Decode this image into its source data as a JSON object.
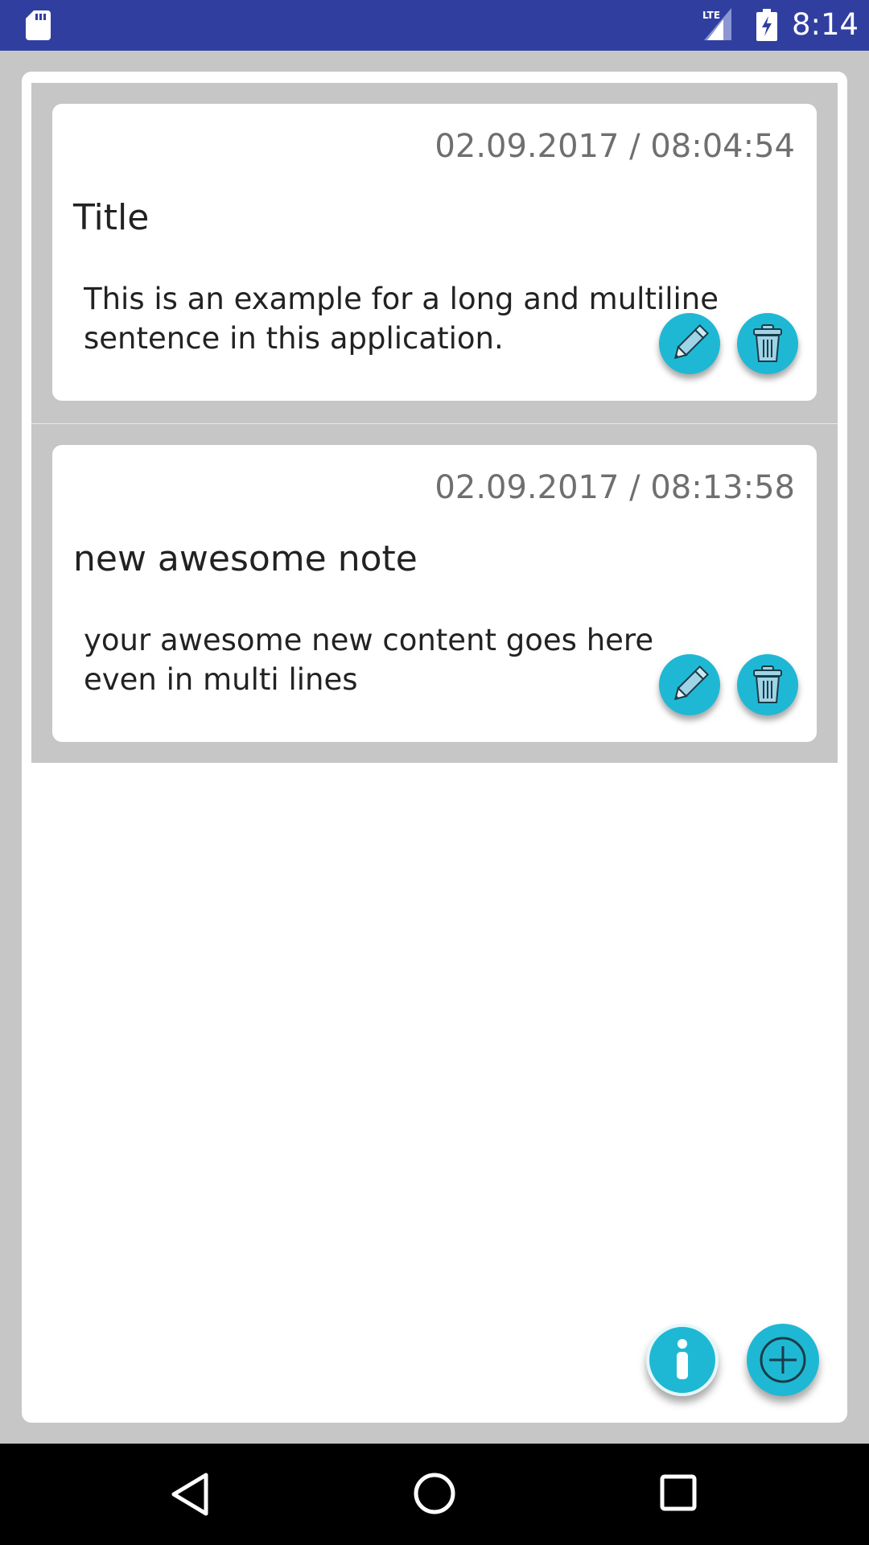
{
  "status_bar": {
    "time": "8:14",
    "network_label": "LTE",
    "icons": [
      "sd-card-icon",
      "lte-signal-icon",
      "battery-charging-icon"
    ],
    "background_color": "#303f9f"
  },
  "notes": [
    {
      "date": "02.09.2017 / 08:04:54",
      "title": "Title",
      "content": "This is an example for a long and multiline\nsentence in this application.",
      "actions": [
        "edit-icon",
        "delete-icon"
      ]
    },
    {
      "date": "02.09.2017 / 08:13:58",
      "title": "new awesome note",
      "content": "your awesome new content goes here\neven in multi lines",
      "actions": [
        "edit-icon",
        "delete-icon"
      ]
    }
  ],
  "fabs": {
    "info_icon": "info-icon",
    "add_icon": "add-circle-icon"
  },
  "nav_bar": {
    "icons": [
      "back-icon",
      "home-icon",
      "recent-apps-icon"
    ]
  },
  "colors": {
    "accent": "#1fb8d4",
    "card_background": "#ffffff",
    "list_background": "#c6c6c6"
  }
}
